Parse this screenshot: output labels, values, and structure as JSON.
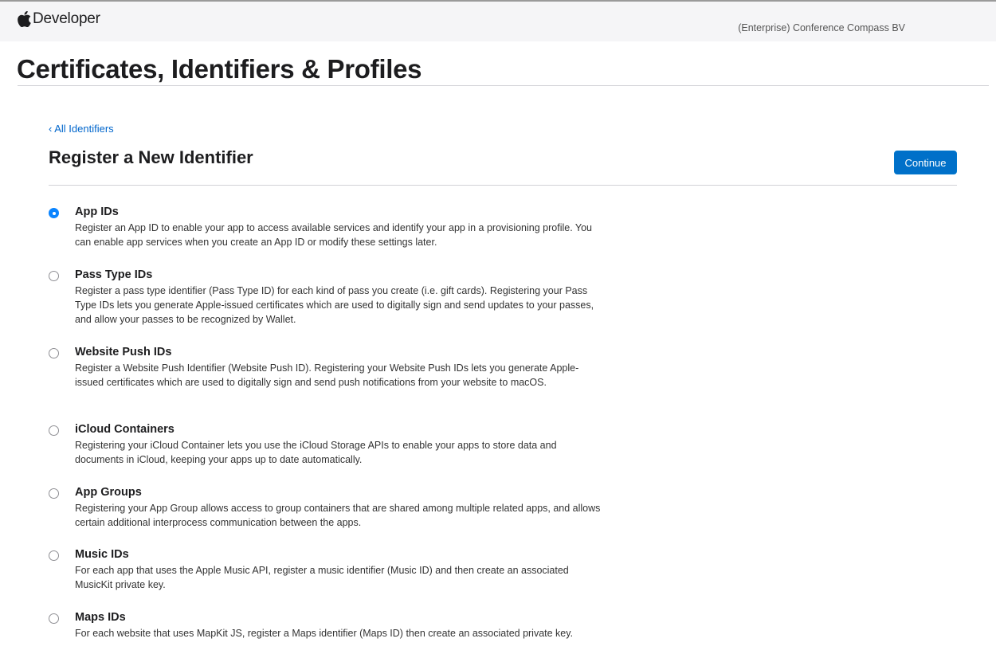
{
  "nav": {
    "brand": "Developer",
    "account": "(Enterprise) Conference Compass BV"
  },
  "page": {
    "title": "Certificates, Identifiers & Profiles"
  },
  "register": {
    "back_link": "‹ All Identifiers",
    "title": "Register a New Identifier",
    "continue_label": "Continue",
    "selected_option": "App IDs",
    "options": [
      {
        "title": "App IDs",
        "desc": "Register an App ID to enable your app to access available services and identify your app in a provisioning profile. You can enable app services when you create an App ID or modify these settings later."
      },
      {
        "title": "Pass Type IDs",
        "desc": "Register a pass type identifier (Pass Type ID) for each kind of pass you create (i.e. gift cards). Registering your Pass Type IDs lets you generate Apple-issued certificates which are used to digitally sign and send updates to your passes, and allow your passes to be recognized by Wallet."
      },
      {
        "title": "Website Push IDs",
        "desc": "Register a Website Push Identifier (Website Push ID). Registering your Website Push IDs lets you generate Apple-issued certificates which are used to digitally sign and send push notifications from your website to macOS."
      },
      {
        "title": "iCloud Containers",
        "desc": "Registering your iCloud Container lets you use the iCloud Storage APIs to enable your apps to store data and documents in iCloud, keeping your apps up to date automatically."
      },
      {
        "title": "App Groups",
        "desc": "Registering your App Group allows access to group containers that are shared among multiple related apps, and allows certain additional interprocess communication between the apps."
      },
      {
        "title": "Music IDs",
        "desc": "For each app that uses the Apple Music API, register a music identifier (Music ID) and then create an associated MusicKit private key."
      },
      {
        "title": "Maps IDs",
        "desc": "For each website that uses MapKit JS, register a Maps identifier (Maps ID) then create an associated private key."
      }
    ]
  }
}
